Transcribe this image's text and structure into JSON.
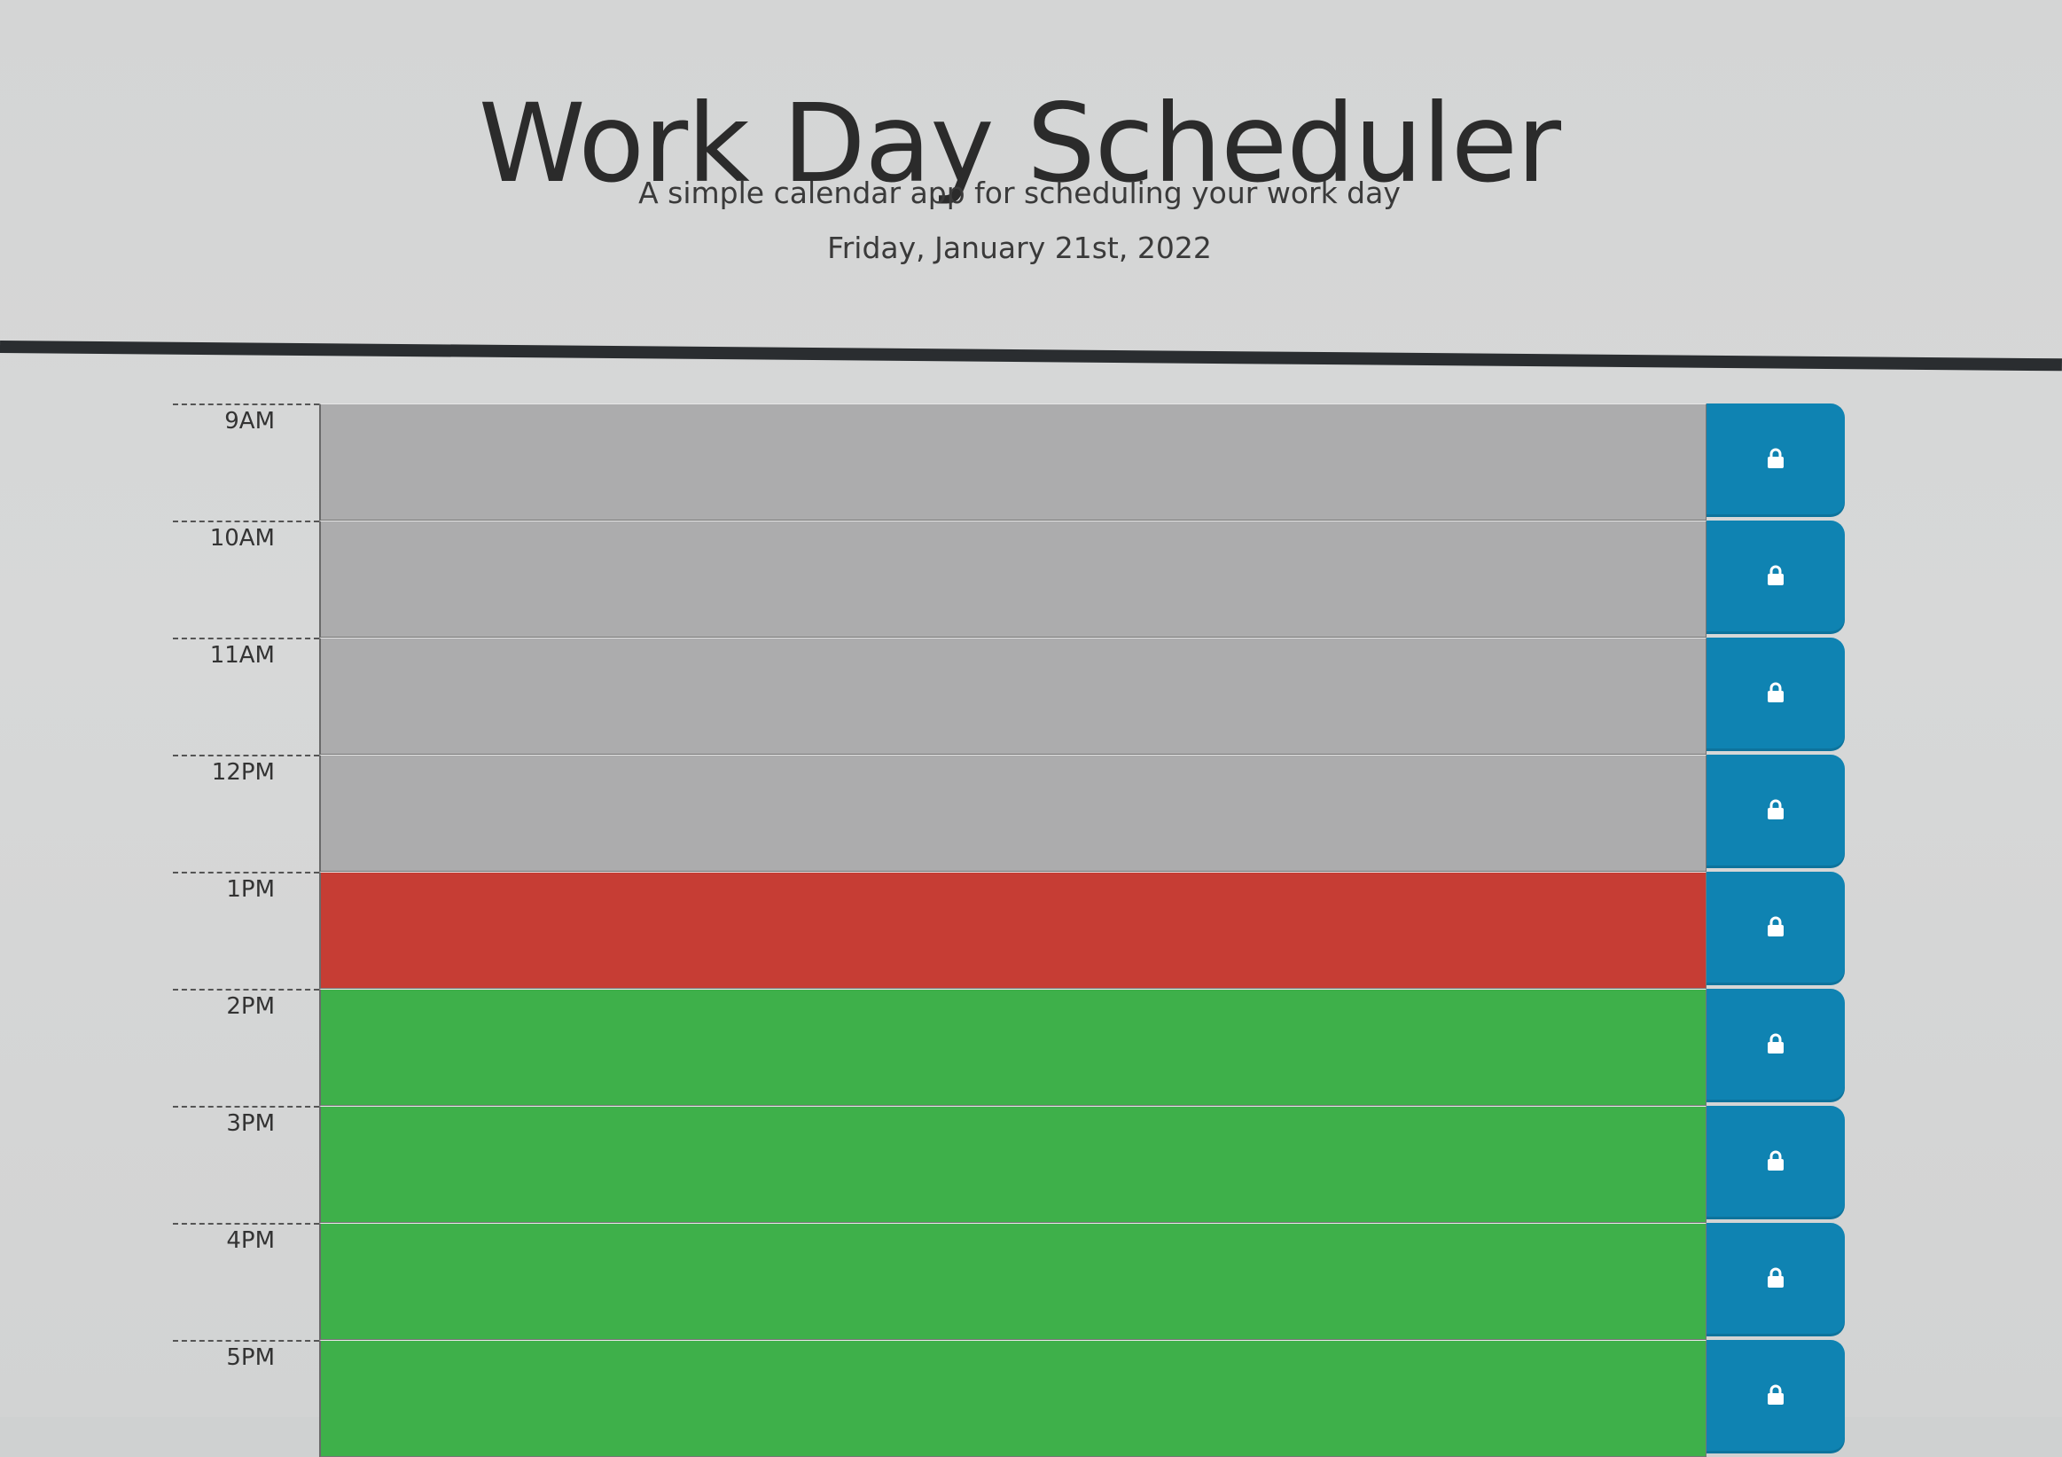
{
  "header": {
    "title": "Work Day Scheduler",
    "subtitle": "A simple calendar app for scheduling your work day",
    "current_date": "Friday, January 21st, 2022"
  },
  "colors": {
    "past": "#acacad",
    "present": "#c63d34",
    "future": "#3eb04a",
    "save_button": "#0f83b2",
    "divider": "#2a2d30"
  },
  "time_blocks": [
    {
      "hour": "9AM",
      "status": "past",
      "text": "",
      "icon": "lock-icon"
    },
    {
      "hour": "10AM",
      "status": "past",
      "text": "",
      "icon": "lock-icon"
    },
    {
      "hour": "11AM",
      "status": "past",
      "text": "",
      "icon": "lock-icon"
    },
    {
      "hour": "12PM",
      "status": "past",
      "text": "",
      "icon": "lock-icon"
    },
    {
      "hour": "1PM",
      "status": "present",
      "text": "",
      "icon": "lock-icon"
    },
    {
      "hour": "2PM",
      "status": "future",
      "text": "",
      "icon": "lock-icon"
    },
    {
      "hour": "3PM",
      "status": "future",
      "text": "",
      "icon": "lock-icon"
    },
    {
      "hour": "4PM",
      "status": "future",
      "text": "",
      "icon": "lock-icon"
    },
    {
      "hour": "5PM",
      "status": "future",
      "text": "",
      "icon": "lock-icon"
    }
  ]
}
